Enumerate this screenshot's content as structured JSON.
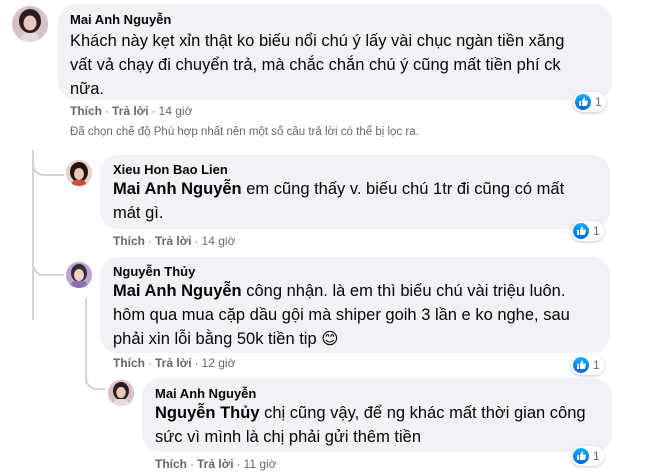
{
  "comments": [
    {
      "author": "Mai Anh Nguyễn",
      "mention": "",
      "lines": [
        "Khách này kẹt xỉn thật ko biếu nổi chú ý lấy vài chục ngàn tiền xăng",
        "vất vả chạy đi chuyển trả, mà chắc chắn chú ý cũng mất tiền phí ck",
        "nữa."
      ],
      "like_label": "Thích",
      "reply_label": "Trả lời",
      "time": "14 giờ",
      "reaction_count": "1"
    },
    {
      "author": "Xieu Hon Bao Lien",
      "mention": "Mai Anh Nguyễn",
      "lines": [
        " em cũng thấy v. biếu chú 1tr đi cũng có mất",
        "mát gì."
      ],
      "like_label": "Thích",
      "reply_label": "Trả lời",
      "time": "14 giờ",
      "reaction_count": "1"
    },
    {
      "author": "Nguyễn Thủy",
      "mention": "Mai Anh Nguyễn",
      "lines": [
        " công nhận. là em thì biếu chú vài triệu luôn.",
        "hôm qua mua cặp dầu gội mà shiper goih 3 lần e ko nghe, sau",
        "phải xin lỗi bằng 50k tiền tip "
      ],
      "emoji": "😊",
      "like_label": "Thích",
      "reply_label": "Trả lời",
      "time": "12 giờ",
      "reaction_count": "1"
    },
    {
      "author": "Mai Anh Nguyễn",
      "mention": "Nguyễn Thủy",
      "lines": [
        " chị cũng vậy, để ng khác mất thời gian công",
        "sức vì mình là chị phải gửi thêm tiền"
      ],
      "like_label": "Thích",
      "reply_label": "Trả lời",
      "time": "11 giờ",
      "reaction_count": "1"
    }
  ],
  "filter_note": "Đã chọn chế độ Phù hợp nhất nên một số câu trả lời có thể bị lọc ra.",
  "colors": {
    "bubble": "#f0f2f5",
    "meta_text": "#65676b",
    "like_blue": "#1877f2"
  },
  "icons": [
    "avatar",
    "like-icon"
  ]
}
